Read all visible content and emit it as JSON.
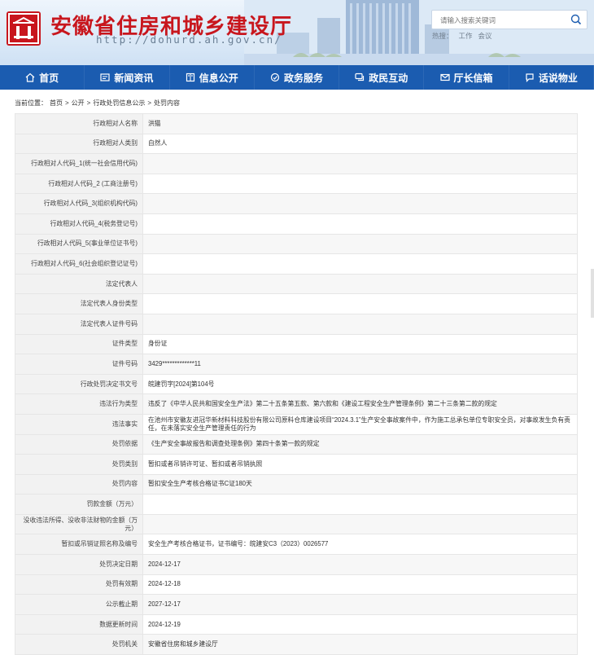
{
  "header": {
    "site_title": "安徽省住房和城乡建设厅",
    "site_url": "http://dohurd.ah.gov.cn/",
    "search_placeholder": "请输入搜索关键词",
    "hot_words": [
      "热搜：",
      "工作",
      "会议"
    ]
  },
  "nav": [
    {
      "label": "首页",
      "icon": "home-icon"
    },
    {
      "label": "新闻资讯",
      "icon": "news-icon"
    },
    {
      "label": "信息公开",
      "icon": "book-icon"
    },
    {
      "label": "政务服务",
      "icon": "service-icon"
    },
    {
      "label": "政民互动",
      "icon": "chat-icon"
    },
    {
      "label": "厅长信箱",
      "icon": "mail-icon"
    },
    {
      "label": "话说物业",
      "icon": "talk-icon"
    }
  ],
  "breadcrumb": {
    "prefix": "当前位置：",
    "items": [
      "首页",
      "公开",
      "行政处罚信息公示",
      "处罚内容"
    ],
    "separator": ">"
  },
  "rows": [
    {
      "label": "行政相对人名称",
      "value": "洪猫"
    },
    {
      "label": "行政相对人类别",
      "value": "自然人"
    },
    {
      "label": "行政相对人代码_1(统一社会信用代码)",
      "value": ""
    },
    {
      "label": "行政相对人代码_2 (工商注册号)",
      "value": ""
    },
    {
      "label": "行政相对人代码_3(组织机构代码)",
      "value": ""
    },
    {
      "label": "行政相对人代码_4(税务登记号)",
      "value": ""
    },
    {
      "label": "行政相对人代码_5(事业单位证书号)",
      "value": ""
    },
    {
      "label": "行政相对人代码_6(社会组织登记证号)",
      "value": ""
    },
    {
      "label": "法定代表人",
      "value": ""
    },
    {
      "label": "法定代表人身份类型",
      "value": ""
    },
    {
      "label": "法定代表人证件号码",
      "value": ""
    },
    {
      "label": "证件类型",
      "value": "身份证"
    },
    {
      "label": "证件号码",
      "value": "3429*************11"
    },
    {
      "label": "行政处罚决定书文号",
      "value": "皖建罚字[2024]第104号"
    },
    {
      "label": "违法行为类型",
      "value": "违反了《中华人民共和国安全生产法》第二十五条第五款、第六款和《建设工程安全生产管理条例》第二十三条第二款的规定"
    },
    {
      "label": "违法事实",
      "value": "在池州市安徽友进冠华新材料科技股份有限公司原料仓库建设项目“2024.3.1”生产安全事故案件中，作为施工总承包单位专职安全员，对事故发生负有责任，在未落实安全生产管理责任的行为"
    },
    {
      "label": "处罚依据",
      "value": "《生产安全事故报告和调查处理条例》第四十条第一款的规定"
    },
    {
      "label": "处罚类别",
      "value": "暂扣或者吊销许可证、暂扣或者吊销执照"
    },
    {
      "label": "处罚内容",
      "value": "暂扣安全生产考核合格证书C证180天"
    },
    {
      "label": "罚款金额（万元）",
      "value": ""
    },
    {
      "label": "没收违法所得、没收非法财物的金额（万元）",
      "value": ""
    },
    {
      "label": "暂扣或吊销证照名称及编号",
      "value": "安全生产考核合格证书，证书编号：皖建安C3（2023）0026577"
    },
    {
      "label": "处罚决定日期",
      "value": "2024-12-17"
    },
    {
      "label": "处罚有效期",
      "value": "2024-12-18"
    },
    {
      "label": "公示截止期",
      "value": "2027-12-17"
    },
    {
      "label": "数据更新时间",
      "value": "2024-12-19"
    },
    {
      "label": "处罚机关",
      "value": "安徽省住房和城乡建设厅"
    }
  ]
}
